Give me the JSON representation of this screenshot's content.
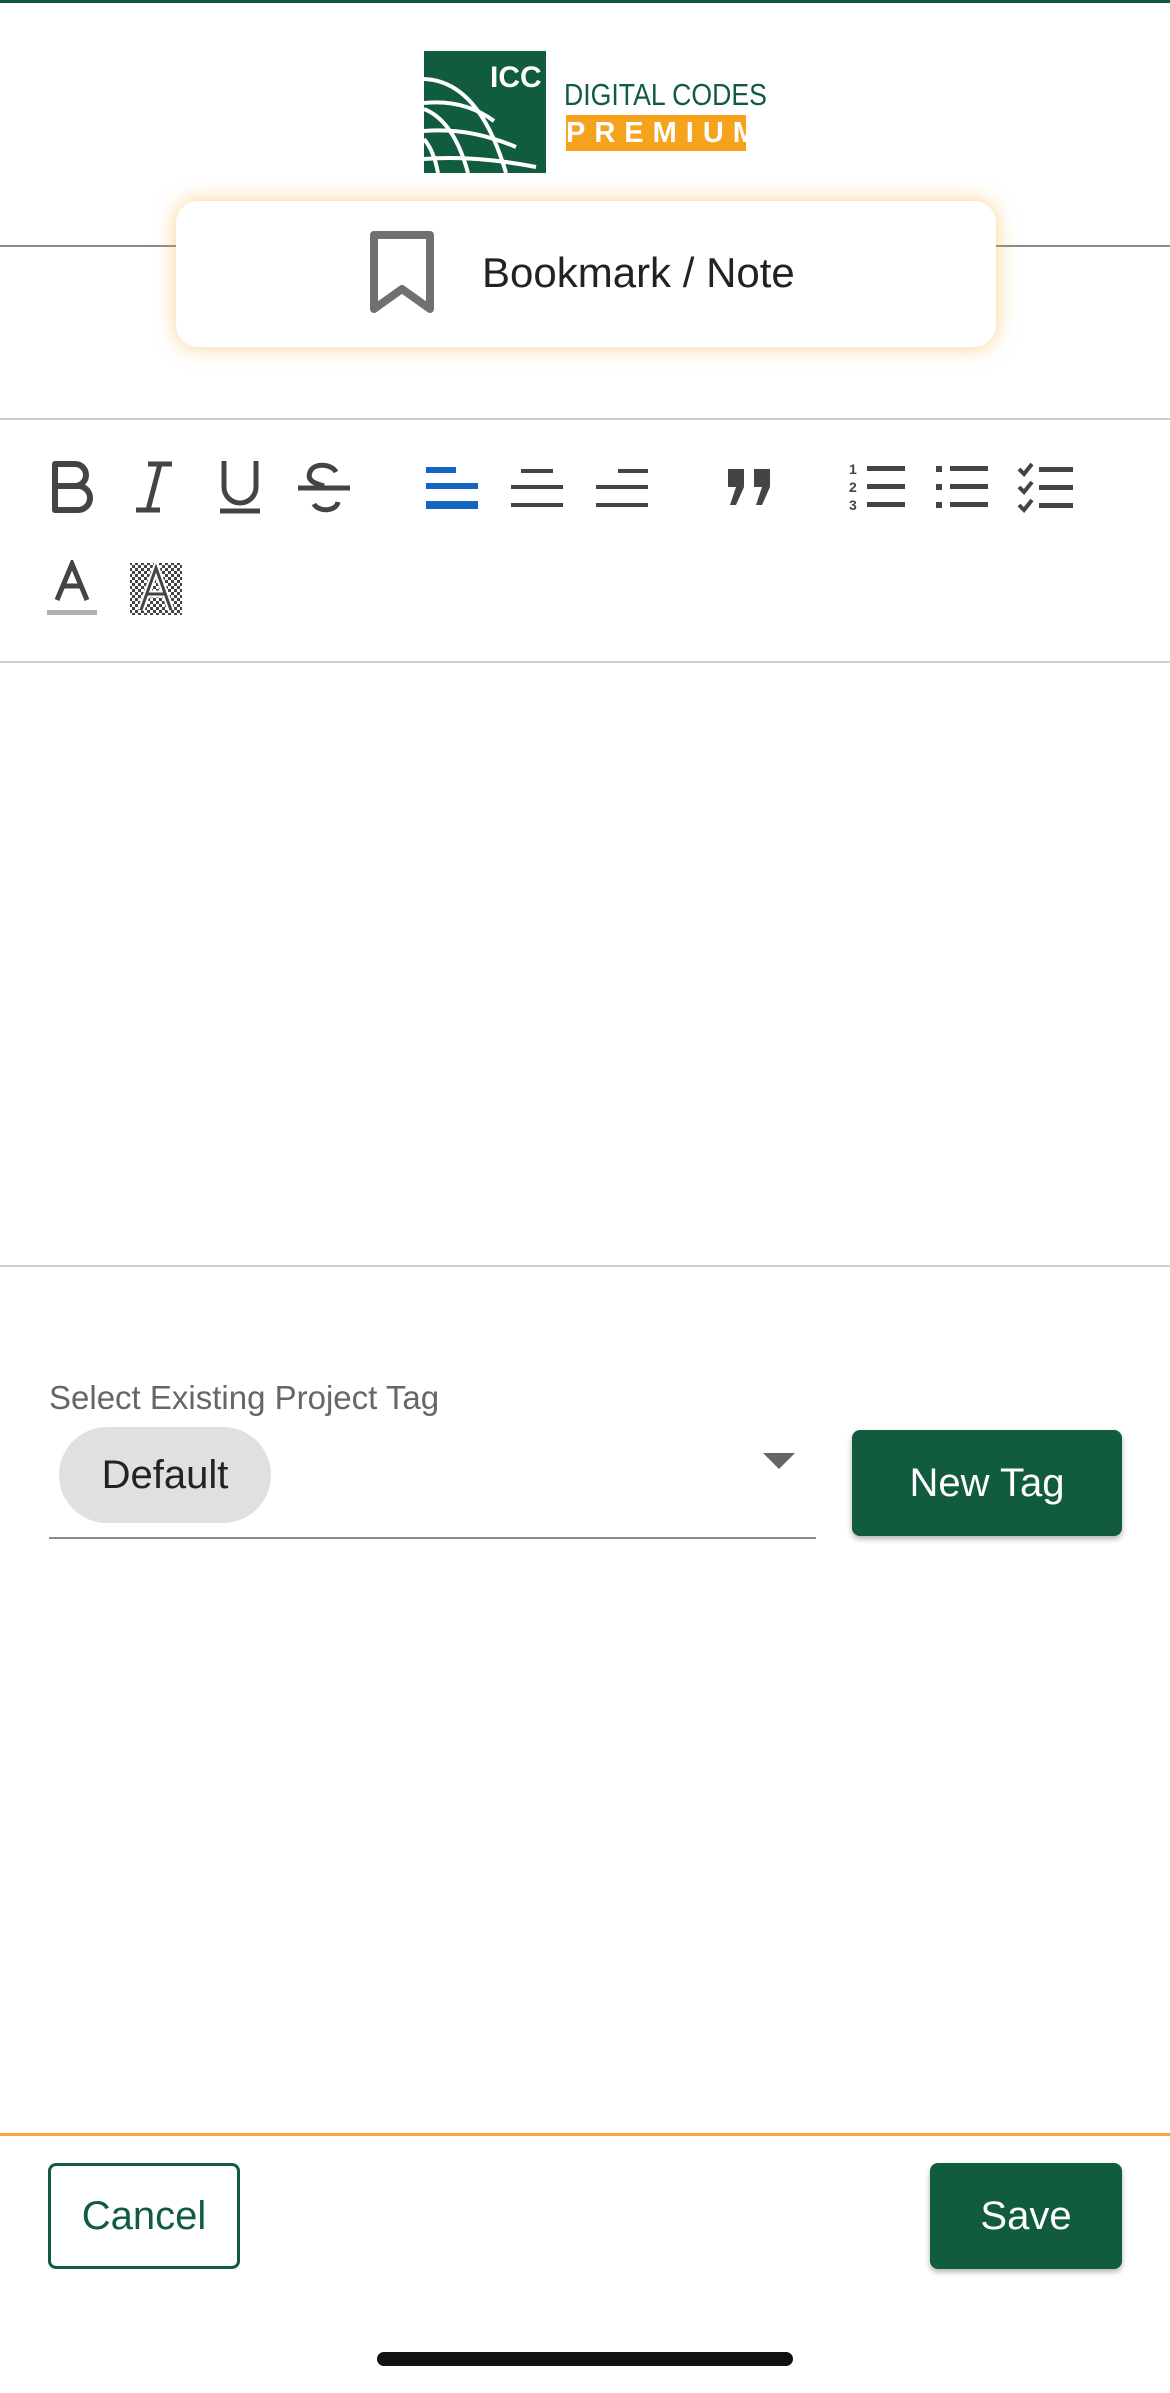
{
  "logo": {
    "mark_text": "ICC",
    "line1": "DIGITAL CODES",
    "line2": "PREMIUM",
    "brand_green": "#115c3e",
    "brand_orange": "#f5a21d"
  },
  "header": {
    "bookmark_icon": "bookmark-icon",
    "title": "Bookmark / Note"
  },
  "toolbar": {
    "buttons": [
      {
        "name": "bold",
        "icon": "bold-icon"
      },
      {
        "name": "italic",
        "icon": "italic-icon"
      },
      {
        "name": "underline",
        "icon": "underline-icon"
      },
      {
        "name": "strikethrough",
        "icon": "strikethrough-icon"
      },
      {
        "name": "align-left",
        "icon": "align-left-icon",
        "active": true
      },
      {
        "name": "align-center",
        "icon": "align-center-icon"
      },
      {
        "name": "align-right",
        "icon": "align-right-icon"
      },
      {
        "name": "blockquote",
        "icon": "quote-icon"
      },
      {
        "name": "ordered-list",
        "icon": "ordered-list-icon"
      },
      {
        "name": "bullet-list",
        "icon": "bullet-list-icon"
      },
      {
        "name": "checklist",
        "icon": "checklist-icon"
      },
      {
        "name": "text-color",
        "icon": "text-color-icon"
      },
      {
        "name": "highlight-color",
        "icon": "highlight-icon"
      }
    ],
    "active_color": "#1565c0"
  },
  "editor": {
    "content": ""
  },
  "tags": {
    "label": "Select Existing Project Tag",
    "selected_chip": "Default",
    "new_tag_label": "New Tag"
  },
  "footer": {
    "cancel_label": "Cancel",
    "save_label": "Save",
    "accent": "#f2a93b"
  }
}
